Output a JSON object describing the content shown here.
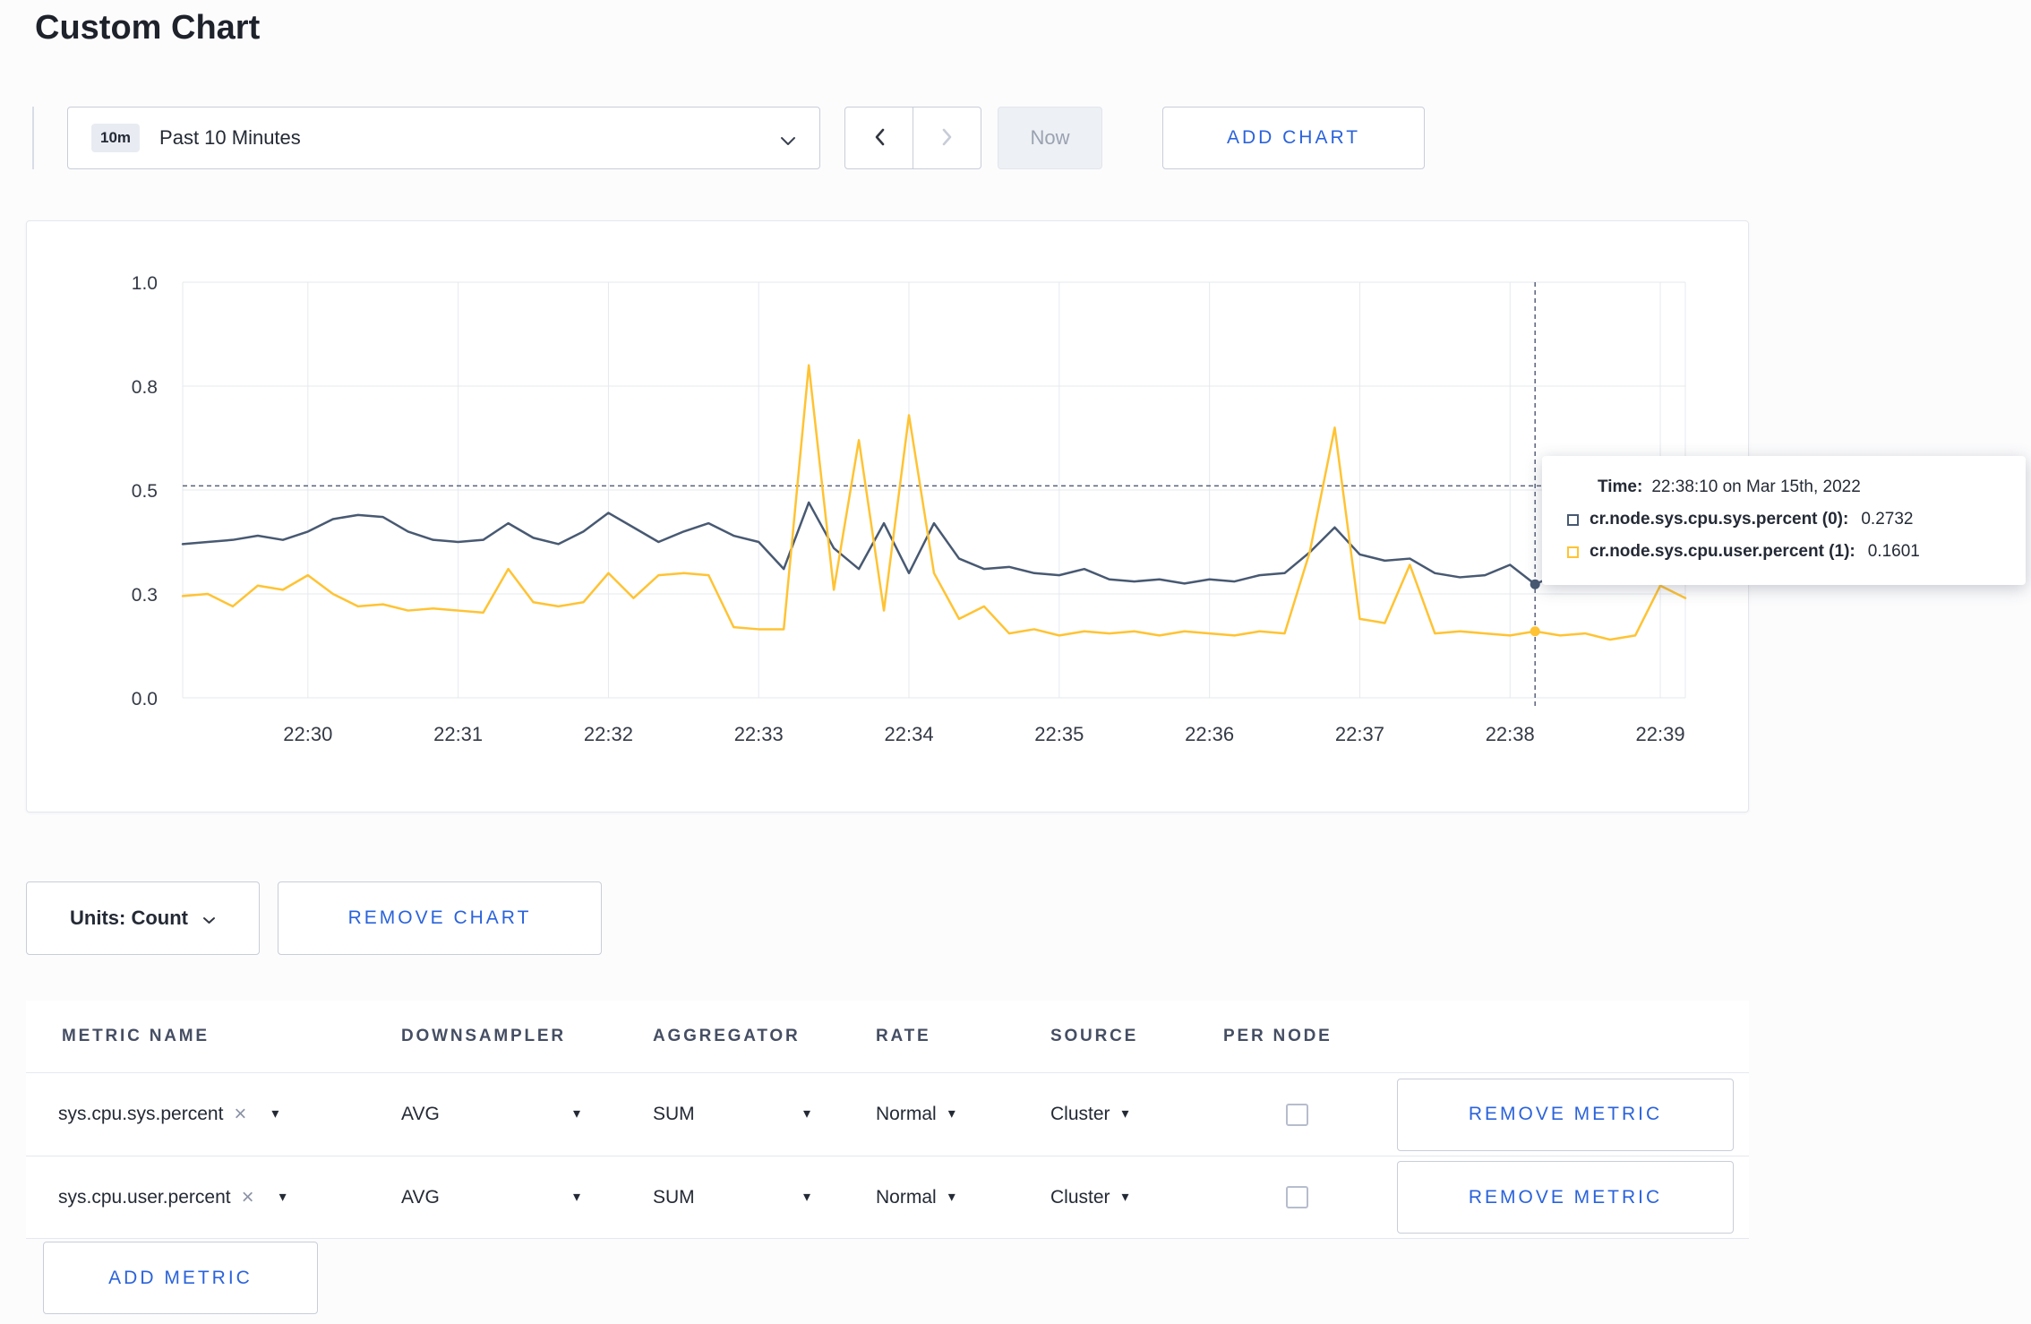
{
  "page": {
    "title": "Custom Chart"
  },
  "toolbar": {
    "time_badge": "10m",
    "time_label": "Past 10 Minutes",
    "now_label": "Now",
    "add_chart_label": "ADD CHART"
  },
  "chart_controls": {
    "units_label": "Units: Count",
    "remove_chart_label": "REMOVE CHART"
  },
  "tooltip": {
    "time_label": "Time:",
    "time_value": "22:38:10 on Mar 15th, 2022",
    "series": [
      {
        "name": "cr.node.sys.cpu.sys.percent (0):",
        "value": "0.2732"
      },
      {
        "name": "cr.node.sys.cpu.user.percent (1):",
        "value": "0.1601"
      }
    ]
  },
  "metrics_table": {
    "headers": [
      "METRIC NAME",
      "DOWNSAMPLER",
      "AGGREGATOR",
      "RATE",
      "SOURCE",
      "PER NODE"
    ],
    "rows": [
      {
        "name": "sys.cpu.sys.percent",
        "downsampler": "AVG",
        "aggregator": "SUM",
        "rate": "Normal",
        "source": "Cluster",
        "per_node": false,
        "remove_label": "REMOVE METRIC"
      },
      {
        "name": "sys.cpu.user.percent",
        "downsampler": "AVG",
        "aggregator": "SUM",
        "rate": "Normal",
        "source": "Cluster",
        "per_node": false,
        "remove_label": "REMOVE METRIC"
      }
    ],
    "add_metric_label": "ADD METRIC"
  },
  "icons": {
    "close": "×",
    "caret_down": "▾"
  },
  "colors": {
    "accent_blue": "#2b63db",
    "series_sys": "#485972",
    "series_user": "#ffc333",
    "grid": "#e6e9ee"
  },
  "chart_data": {
    "type": "line",
    "title": "",
    "x_start": "22:29:10",
    "x_end": "22:39:10",
    "interval_seconds": 10,
    "x_ticks": [
      "22:30",
      "22:31",
      "22:32",
      "22:33",
      "22:34",
      "22:35",
      "22:36",
      "22:37",
      "22:38",
      "22:39"
    ],
    "y_tick_labels": [
      "0.0",
      "0.3",
      "0.5",
      "0.8",
      "1.0"
    ],
    "y_tick_values": [
      0,
      0.25,
      0.5,
      0.75,
      1.0
    ],
    "ylim": [
      0,
      1.0
    ],
    "grid": true,
    "legend_position": "tooltip",
    "series": [
      {
        "name": "cr.node.sys.cpu.sys.percent",
        "color": "#485972",
        "values": [
          0.37,
          0.375,
          0.38,
          0.39,
          0.38,
          0.4,
          0.43,
          0.44,
          0.435,
          0.4,
          0.38,
          0.375,
          0.38,
          0.42,
          0.385,
          0.37,
          0.4,
          0.445,
          0.41,
          0.375,
          0.4,
          0.42,
          0.39,
          0.375,
          0.31,
          0.47,
          0.36,
          0.31,
          0.42,
          0.3,
          0.42,
          0.335,
          0.31,
          0.315,
          0.3,
          0.295,
          0.31,
          0.285,
          0.28,
          0.285,
          0.275,
          0.285,
          0.28,
          0.295,
          0.3,
          0.35,
          0.41,
          0.345,
          0.33,
          0.335,
          0.3,
          0.29,
          0.295,
          0.32,
          0.2732,
          0.3,
          0.31,
          0.3,
          0.285,
          0.3,
          0.3
        ]
      },
      {
        "name": "cr.node.sys.cpu.user.percent",
        "color": "#ffc333",
        "values": [
          0.245,
          0.25,
          0.22,
          0.27,
          0.26,
          0.295,
          0.25,
          0.22,
          0.225,
          0.21,
          0.215,
          0.21,
          0.205,
          0.31,
          0.23,
          0.22,
          0.23,
          0.3,
          0.24,
          0.295,
          0.3,
          0.295,
          0.17,
          0.165,
          0.165,
          0.8,
          0.26,
          0.62,
          0.21,
          0.68,
          0.3,
          0.19,
          0.22,
          0.155,
          0.165,
          0.15,
          0.16,
          0.155,
          0.16,
          0.15,
          0.16,
          0.155,
          0.15,
          0.16,
          0.155,
          0.35,
          0.65,
          0.19,
          0.18,
          0.32,
          0.155,
          0.16,
          0.155,
          0.15,
          0.1601,
          0.15,
          0.155,
          0.14,
          0.15,
          0.27,
          0.24
        ]
      }
    ],
    "crosshair": {
      "index": 54,
      "time": "22:38:10",
      "hline_value": 0.51
    }
  }
}
